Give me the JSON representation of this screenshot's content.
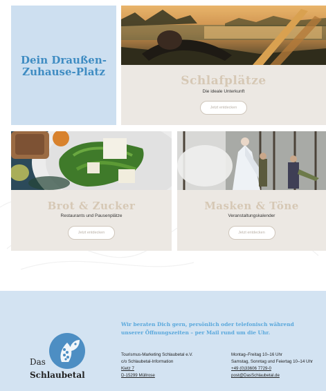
{
  "hero": {
    "title_line1": "Dein Draußen-",
    "title_line2": "Zuhause-Platz"
  },
  "cards": [
    {
      "title": "Schlafplätze",
      "subtitle": "Die ideale Unterkunft",
      "button": "Jetzt entdecken"
    },
    {
      "title": "Brot & Zucker",
      "subtitle": "Restaurants und Pausenplätze",
      "button": "Jetzt entdecken"
    },
    {
      "title": "Masken & Töne",
      "subtitle": "Veranstaltungskalender",
      "button": "Jetzt entdecken"
    }
  ],
  "footer": {
    "lead_line1": "Wir beraten Dich gern, persönlich oder telefonisch während",
    "lead_line2": "unserer Öffnungszeiten – per Mail rund um die Uhr.",
    "address": {
      "line1": "Tourismus-Marketing Schlaubetal e.V.",
      "line2": "c/o Schlaubetal-Information",
      "street": "Kietz 7",
      "city": "D-15299 Müllrose"
    },
    "hours": {
      "line1": "Montag–Freitag 10–16 Uhr",
      "line2": "Samstag, Sonntag und Feiertag 10–14 Uhr",
      "phone": "+49 (0)33606 7729-0",
      "email": "post@DasSchlaubetal.de"
    },
    "logo": {
      "das": "Das",
      "name": "Schlaubetal",
      "icon": "leaf-logo-icon",
      "color": "#4d8ec3"
    }
  },
  "colors": {
    "accent": "#3f8cc2",
    "card_title": "#d6c8b5",
    "card_bg": "#ece8e3",
    "footer_bg": "#d3e3f2"
  }
}
